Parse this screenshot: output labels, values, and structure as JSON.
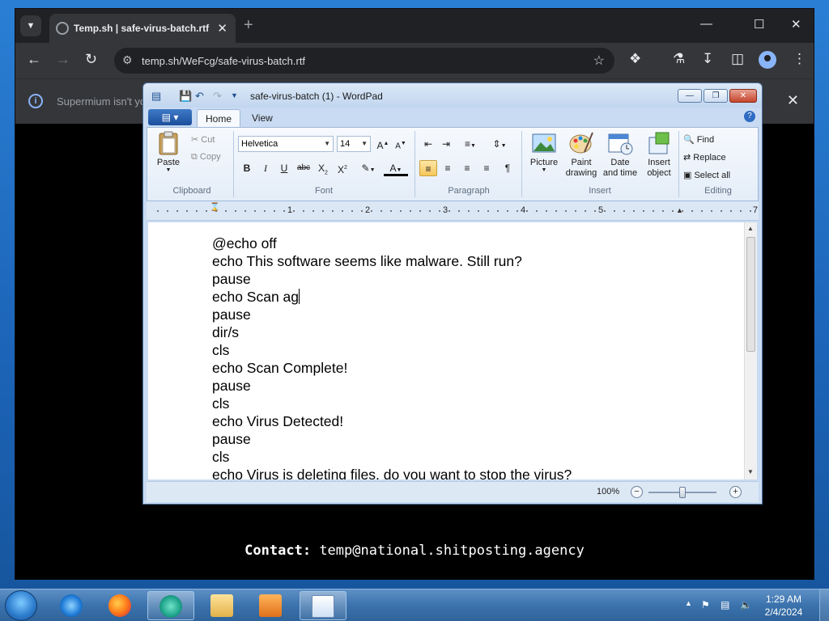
{
  "browser": {
    "tab_title": "Temp.sh | safe-virus-batch.rtf",
    "url": "temp.sh/WeFcg/safe-virus-batch.rtf",
    "infobar_text": "Supermium isn't yo",
    "contact_label": "Contact:",
    "contact_email": "temp@national.shitposting.agency"
  },
  "wordpad": {
    "title": "safe-virus-batch (1) - WordPad",
    "tabs": [
      "Home",
      "View"
    ],
    "clipboard": {
      "paste": "Paste",
      "cut": "Cut",
      "copy": "Copy",
      "group": "Clipboard"
    },
    "font": {
      "family": "Helvetica",
      "size": "14",
      "group": "Font"
    },
    "paragraph": {
      "group": "Paragraph"
    },
    "insert": {
      "picture": "Picture",
      "paint": "Paint drawing",
      "datetime": "Date and time",
      "object": "Insert object",
      "group": "Insert"
    },
    "editing": {
      "find": "Find",
      "replace": "Replace",
      "select_all": "Select all",
      "group": "Editing"
    },
    "ruler": [
      "1",
      "2",
      "3",
      "4",
      "5",
      "7"
    ],
    "document_lines": [
      "@echo off",
      "echo This software seems like malware. Still run?",
      "pause",
      "echo Scan ag",
      "pause",
      "dir/s",
      "cls",
      "echo Scan Complete!",
      "pause",
      "cls",
      "echo Virus Detected!",
      "pause",
      "cls",
      "echo Virus is deleting files, do you want to stop the virus?"
    ],
    "zoom": "100%"
  },
  "taskbar": {
    "time": "1:29 AM",
    "date": "2/4/2024"
  }
}
